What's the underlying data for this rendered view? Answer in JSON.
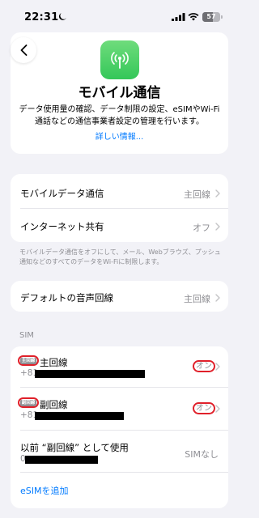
{
  "status_bar": {
    "time": "22:31",
    "battery_percent": "57",
    "battery_level": 0.57,
    "icons": [
      "moon-icon",
      "signal-icon",
      "wifi-icon",
      "battery-icon"
    ]
  },
  "header": {
    "back_icon": "chevron-left-icon",
    "app_icon": "antenna-icon",
    "title": "モバイル通信",
    "description": "データ使用量の確認、データ制限の設定、eSIMやWi-Fi通話などの通信事業者設定の管理を行います。",
    "details_link": "詳しい情報..."
  },
  "data_group": {
    "rows": [
      {
        "label": "モバイルデータ通信",
        "value": "主回線"
      },
      {
        "label": "インターネット共有",
        "value": "オフ"
      }
    ],
    "footnote": "モバイルデータ通信をオフにして、メール、Webブラウズ、プッシュ通知などのすべてのデータをWi-Fiに制限します。"
  },
  "voice_group": {
    "label": "デフォルトの音声回線",
    "value": "主回線"
  },
  "sim_section": {
    "header": "SIM",
    "lines": [
      {
        "badge": "主回線",
        "name": "主回線",
        "number_prefix": "+81",
        "value": "オン"
      },
      {
        "badge": "副回線",
        "name": "副回線",
        "number_prefix": "+81",
        "value": "オン"
      }
    ],
    "former": {
      "label": "以前 “副回線” として使用",
      "prefix": "0",
      "value": "SIMなし"
    },
    "add_esim": "eSIMを追加"
  },
  "colors": {
    "accent": "#007aff",
    "app_icon_green": "#34c759",
    "annotation_red": "#e0202a",
    "background": "#f2f2f7"
  }
}
